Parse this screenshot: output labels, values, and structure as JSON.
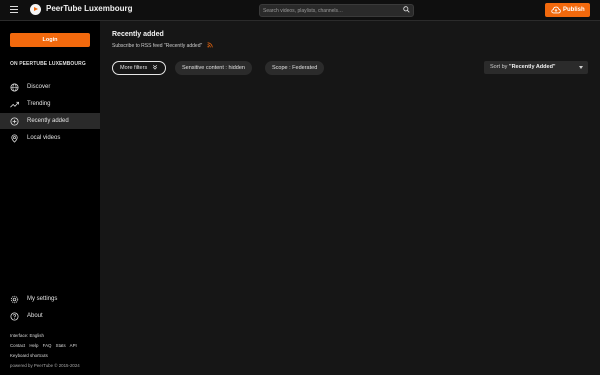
{
  "header": {
    "brand": "PeerTube Luxembourg",
    "search_placeholder": "Search videos, playlists, channels…",
    "publish_label": "Publish"
  },
  "sidebar": {
    "login_label": "Login",
    "section_title": "ON PEERTUBE LUXEMBOURG",
    "items": [
      {
        "label": "Discover",
        "icon": "globe-icon"
      },
      {
        "label": "Trending",
        "icon": "trending-icon"
      },
      {
        "label": "Recently added",
        "icon": "plus-circle-icon"
      },
      {
        "label": "Local videos",
        "icon": "home-icon"
      }
    ],
    "bottom_items": [
      {
        "label": "My settings",
        "icon": "gear-icon"
      },
      {
        "label": "About",
        "icon": "help-icon"
      }
    ],
    "footer": {
      "interface": "Interface: English",
      "links": [
        "Contact",
        "Help",
        "FAQ",
        "Stats",
        "API"
      ],
      "shortcuts": "Keyboard shortcuts",
      "powered": "powered by PeerTube © 2015-2024"
    }
  },
  "main": {
    "title": "Recently added",
    "rss_text": "Subscribe to RSS feed \"Recently added\"",
    "filters": {
      "more": "More filters",
      "sensitive": "Sensitive content : hidden",
      "scope": "Scope : Federated"
    },
    "sort": {
      "prefix": "Sort by",
      "value": "\"Recently Added\""
    }
  },
  "colors": {
    "accent": "#f2690d",
    "background": "#161616",
    "sidebar": "#000000",
    "active_item": "#2a2a2a"
  }
}
